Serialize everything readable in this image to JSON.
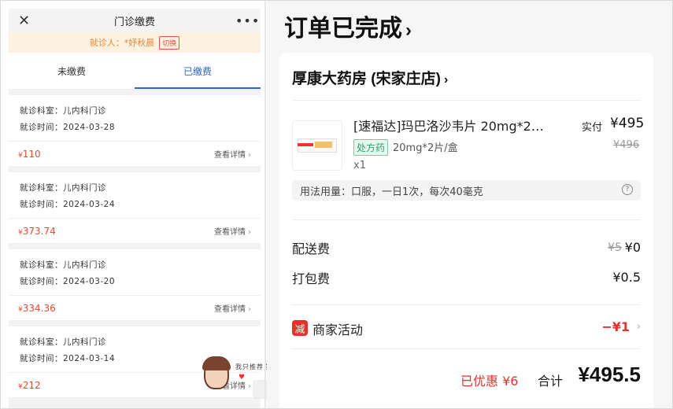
{
  "left": {
    "title": "门诊缴费",
    "close_icon": "close-icon",
    "more_icon": "more-icon",
    "patient_text": "就诊人：*妤秋晨",
    "switch_label": "切换",
    "tabs": [
      {
        "label": "未缴费"
      },
      {
        "label": "已缴费"
      }
    ],
    "records": [
      {
        "dept": "就诊科室：儿内科门诊",
        "time": "就诊时间：2024-03-28",
        "yen": "¥",
        "amount": "110",
        "detail": "查看详情"
      },
      {
        "dept": "就诊科室：儿内科门诊",
        "time": "就诊时间：2024-03-24",
        "yen": "¥",
        "amount": "373.74",
        "detail": "查看详情"
      },
      {
        "dept": "就诊科室：儿内科门诊",
        "time": "就诊时间：2024-03-20",
        "yen": "¥",
        "amount": "334.36",
        "detail": "查看详情"
      },
      {
        "dept": "就诊科室：儿内科门诊",
        "time": "就诊时间：2024-03-14",
        "yen": "¥",
        "amount": "212",
        "detail": "查看详情"
      }
    ],
    "sticker_text": "我只推荐自己真在用的"
  },
  "right": {
    "status": "订单已完成",
    "store": "厚康大药房 (宋家庄店)",
    "product": {
      "name": "[速福达]玛巴洛沙韦片 20mg*2…",
      "pay_label": "实付",
      "pay_amount": "¥495",
      "rx_badge": "处方药",
      "spec": "20mg*2片/盒",
      "orig_price": "¥496",
      "qty": "x1"
    },
    "usage": "用法用量：口服，一日1次，每次40毫克",
    "fees": [
      {
        "label": "配送费",
        "orig": "¥5",
        "value": "¥0"
      },
      {
        "label": "打包费",
        "orig": "",
        "value": "¥0.5"
      }
    ],
    "promo": {
      "icon_text": "减",
      "label": "商家活动",
      "value": "−¥1"
    },
    "summary": {
      "saved": "已优惠 ¥6",
      "total_label": "合计",
      "total": "¥495.5"
    }
  }
}
